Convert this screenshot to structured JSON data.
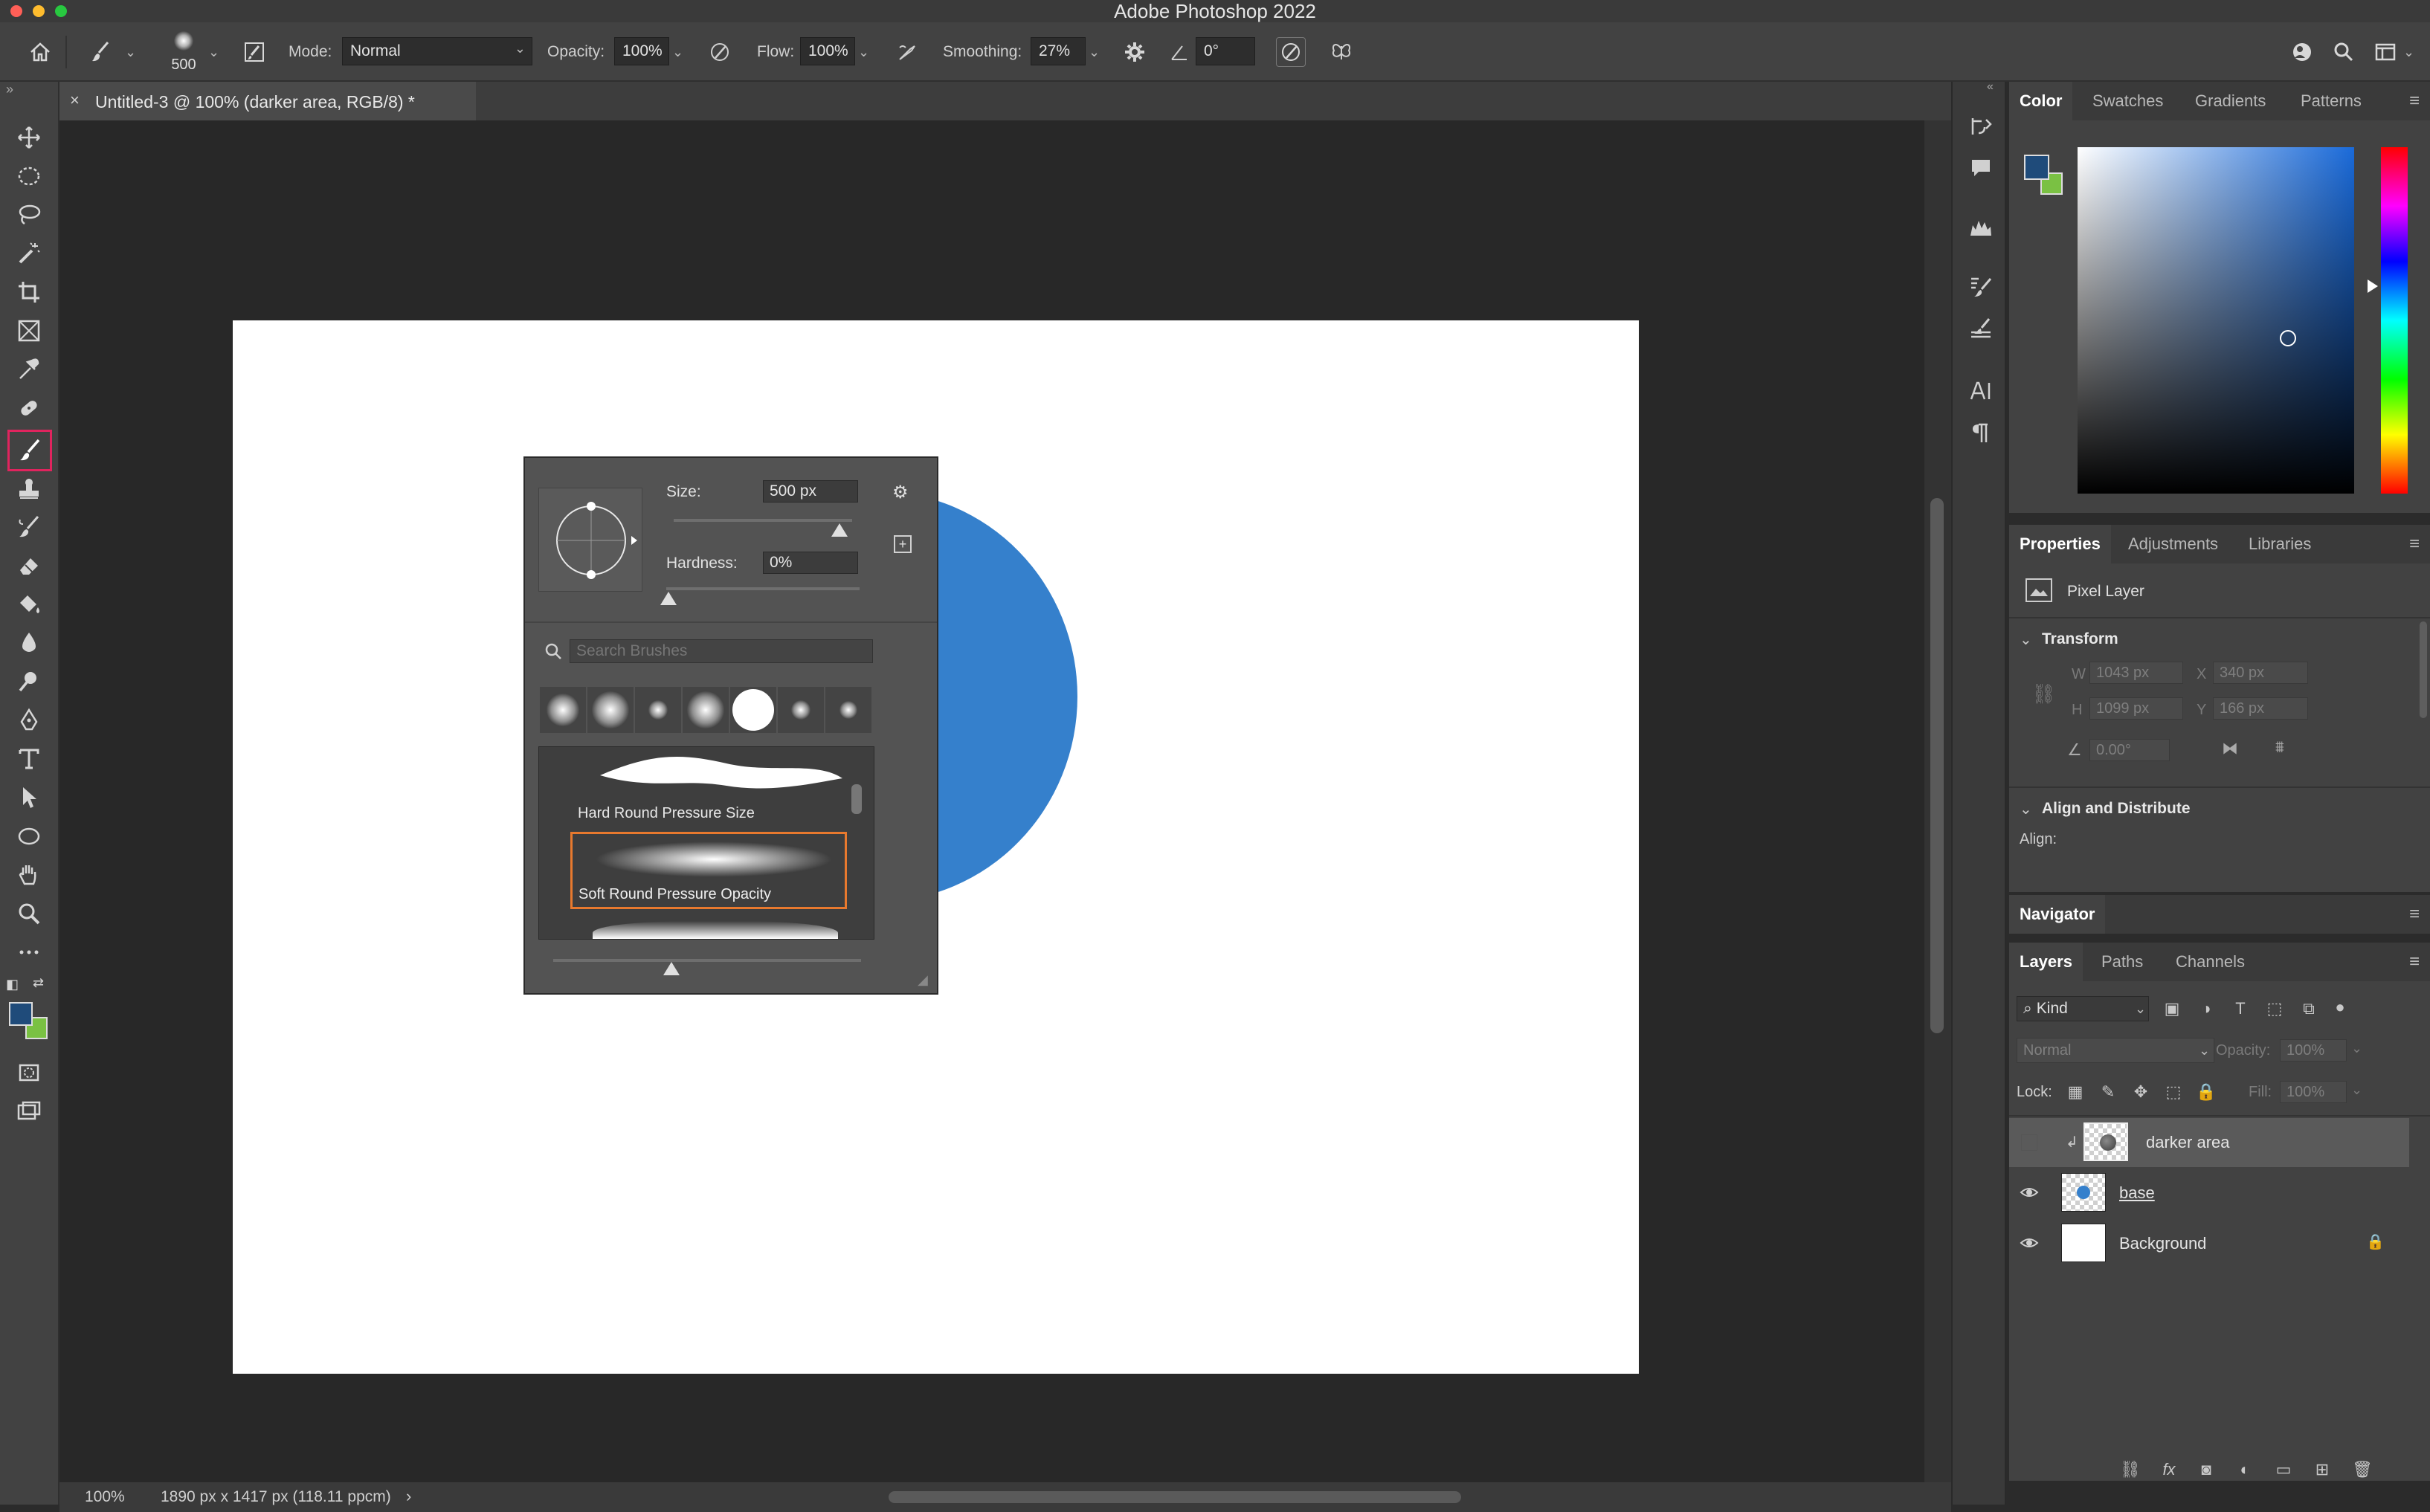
{
  "app": {
    "title": "Adobe Photoshop 2022"
  },
  "colors": {
    "foreground": "#1f4b7a",
    "background": "#7ac143",
    "shape": "#3580cc",
    "selected_tool_border": "#e0245e",
    "brush_highlight": "#e8792e"
  },
  "options_bar": {
    "brush_size": "500",
    "mode_label": "Mode:",
    "mode_value": "Normal",
    "opacity_label": "Opacity:",
    "opacity_value": "100%",
    "flow_label": "Flow:",
    "flow_value": "100%",
    "smoothing_label": "Smoothing:",
    "smoothing_value": "27%",
    "angle_value": "0°"
  },
  "document": {
    "tab_title": "Untitled-3 @ 100% (darker area, RGB/8) *"
  },
  "status": {
    "zoom": "100%",
    "info": "1890 px x 1417 px (118.11 ppcm)"
  },
  "brush_popup": {
    "size_label": "Size:",
    "size_value": "500 px",
    "hardness_label": "Hardness:",
    "hardness_value": "0%",
    "search_placeholder": "Search Brushes",
    "brushes": [
      {
        "name": "Hard Round Pressure Size"
      },
      {
        "name": "Soft Round Pressure Opacity"
      }
    ]
  },
  "color_panel": {
    "tabs": [
      "Color",
      "Swatches",
      "Gradients",
      "Patterns"
    ]
  },
  "properties_panel": {
    "tabs": [
      "Properties",
      "Adjustments",
      "Libraries"
    ],
    "layer_type": "Pixel Layer",
    "transform_label": "Transform",
    "w_label": "W",
    "w_value": "1043 px",
    "x_label": "X",
    "x_value": "340 px",
    "h_label": "H",
    "h_value": "1099 px",
    "y_label": "Y",
    "y_value": "166 px",
    "angle_value": "0.00°",
    "align_label": "Align and Distribute",
    "align_sub": "Align:"
  },
  "navigator": {
    "label": "Navigator"
  },
  "layers_panel": {
    "tabs": [
      "Layers",
      "Paths",
      "Channels"
    ],
    "filter_value": "Kind",
    "blend_mode": "Normal",
    "opacity_label": "Opacity:",
    "opacity_value": "100%",
    "lock_label": "Lock:",
    "fill_label": "Fill:",
    "fill_value": "100%",
    "layers": [
      {
        "name": "darker area"
      },
      {
        "name": "base"
      },
      {
        "name": "Background"
      }
    ]
  }
}
